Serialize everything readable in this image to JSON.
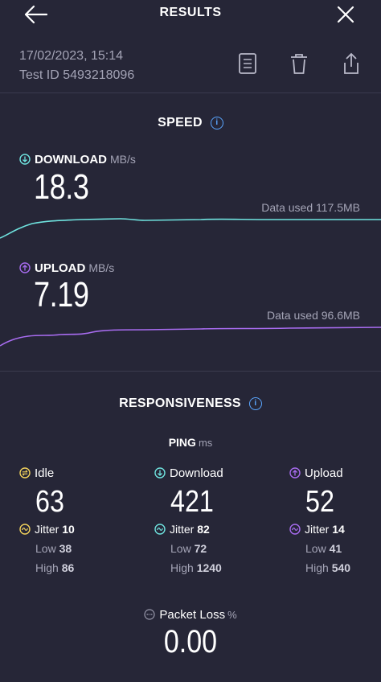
{
  "header": {
    "title": "RESULTS"
  },
  "meta": {
    "datetime": "17/02/2023, 15:14",
    "test_id": "Test ID 5493218096"
  },
  "speed": {
    "title": "SPEED",
    "download": {
      "label": "DOWNLOAD",
      "unit": "MB/s",
      "value": "18.3",
      "data_used": "Data used 117.5MB"
    },
    "upload": {
      "label": "UPLOAD",
      "unit": "MB/s",
      "value": "7.19",
      "data_used": "Data used 96.6MB"
    }
  },
  "responsiveness": {
    "title": "RESPONSIVENESS",
    "ping_label": "PING",
    "ping_unit": "ms",
    "idle": {
      "label": "Idle",
      "value": "63",
      "jitter_label": "Jitter",
      "jitter": "10",
      "low_label": "Low",
      "low": "38",
      "high_label": "High",
      "high": "86"
    },
    "download": {
      "label": "Download",
      "value": "421",
      "jitter_label": "Jitter",
      "jitter": "82",
      "low_label": "Low",
      "low": "72",
      "high_label": "High",
      "high": "1240"
    },
    "upload": {
      "label": "Upload",
      "value": "52",
      "jitter_label": "Jitter",
      "jitter": "14",
      "low_label": "Low",
      "low": "41",
      "high_label": "High",
      "high": "540"
    }
  },
  "packet_loss": {
    "label": "Packet Loss",
    "unit": "%",
    "value": "0.00"
  },
  "colors": {
    "download": "#6fe3df",
    "upload": "#a86cf0",
    "idle": "#f2d25c",
    "info": "#5aa6ff",
    "background": "#262637"
  },
  "icons": [
    "back-arrow-icon",
    "close-icon",
    "report-icon",
    "trash-icon",
    "share-icon",
    "info-icon",
    "download-arrow-icon",
    "upload-arrow-icon",
    "idle-icon",
    "jitter-icon",
    "packet-loss-icon"
  ]
}
